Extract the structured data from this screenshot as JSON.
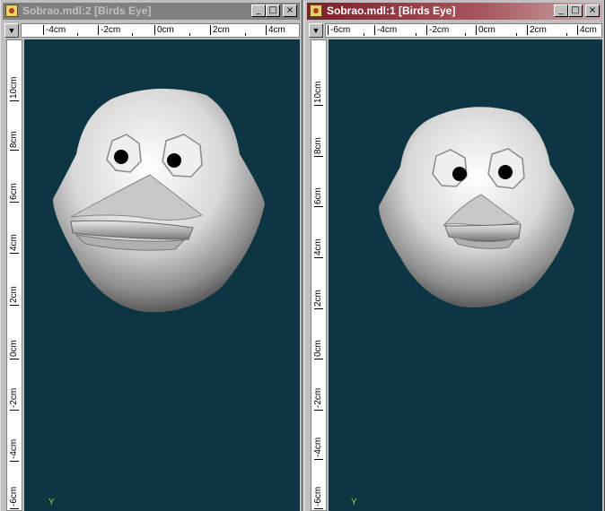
{
  "windows": [
    {
      "title": "Sobrao.mdl:2 [Birds Eye]",
      "state": "inactive",
      "buttons": {
        "minimize": "_",
        "maximize": "□",
        "close": "×"
      },
      "ruler_top": [
        "-4cm",
        "-2cm",
        "0cm",
        "2cm",
        "4cm"
      ],
      "ruler_left": [
        "10cm",
        "8cm",
        "6cm",
        "4cm",
        "2cm",
        "0cm",
        "-2cm",
        "-4cm",
        "-6cm"
      ],
      "axis_label": "Y"
    },
    {
      "title": "Sobrao.mdl:1 [Birds Eye]",
      "state": "active",
      "buttons": {
        "minimize": "_",
        "maximize": "□",
        "close": "×"
      },
      "ruler_top": [
        "-6cm",
        "-4cm",
        "-2cm",
        "0cm",
        "2cm",
        "4cm"
      ],
      "ruler_left": [
        "10cm",
        "8cm",
        "6cm",
        "4cm",
        "2cm",
        "0cm",
        "-2cm",
        "-4cm",
        "-6cm"
      ],
      "axis_label": "Y"
    }
  ],
  "colors": {
    "viewport_bg": "#0d3642",
    "active_title": "#7a1f2b",
    "inactive_title": "#808080"
  },
  "menu_arrow": "▼"
}
